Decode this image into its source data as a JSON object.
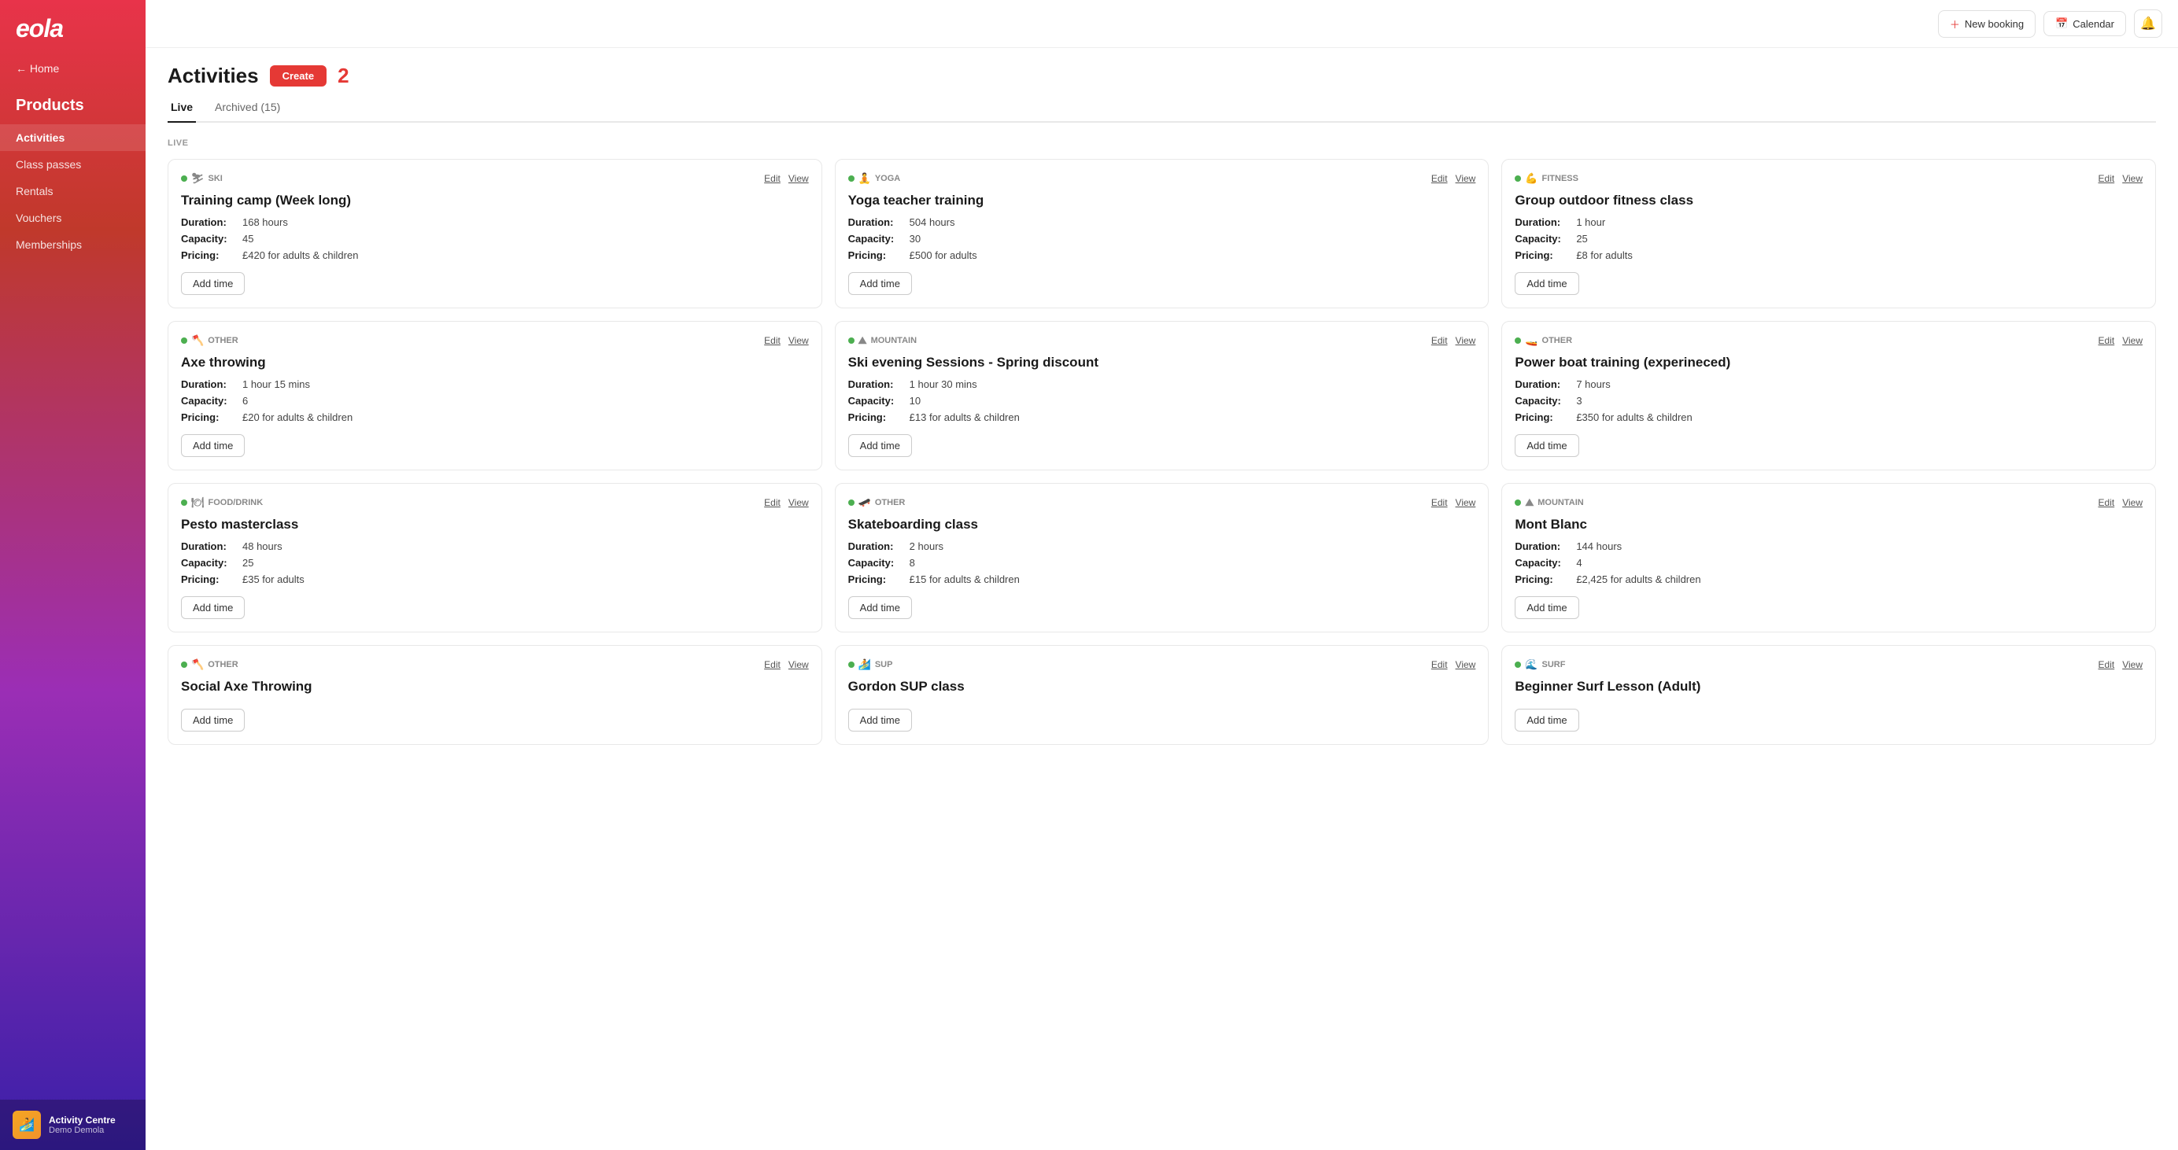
{
  "sidebar": {
    "logo": "eola",
    "home_label": "← Home",
    "products_label": "Products",
    "nav_items": [
      {
        "label": "Activities",
        "active": true
      },
      {
        "label": "Class passes",
        "active": false
      },
      {
        "label": "Rentals",
        "active": false
      },
      {
        "label": "Vouchers",
        "active": false
      },
      {
        "label": "Memberships",
        "active": false
      }
    ],
    "footer": {
      "title": "Activity Centre",
      "subtitle": "Demo Demola",
      "icon": "🏄"
    }
  },
  "header": {
    "new_booking_label": "New booking",
    "calendar_label": "Calendar",
    "bell_icon": "🔔"
  },
  "page": {
    "title": "Activities",
    "create_label": "Create",
    "badge": "2",
    "tabs": [
      {
        "label": "Live",
        "active": true
      },
      {
        "label": "Archived (15)",
        "active": false
      }
    ],
    "section_label": "LIVE"
  },
  "activities": [
    {
      "type": "SKI",
      "type_icon": "⛷",
      "title": "Training camp (Week long)",
      "duration": "168 hours",
      "capacity": "45",
      "pricing": "£420 for adults & children",
      "add_time_label": "Add time"
    },
    {
      "type": "YOGA",
      "type_icon": "🧘",
      "title": "Yoga teacher training",
      "duration": "504 hours",
      "capacity": "30",
      "pricing": "£500 for adults",
      "add_time_label": "Add time"
    },
    {
      "type": "FITNESS",
      "type_icon": "💪",
      "title": "Group outdoor fitness class",
      "duration": "1 hour",
      "capacity": "25",
      "pricing": "£8 for adults",
      "add_time_label": "Add time"
    },
    {
      "type": "OTHER",
      "type_icon": "🪓",
      "title": "Axe throwing",
      "duration": "1 hour 15 mins",
      "capacity": "6",
      "pricing": "£20 for adults & children",
      "add_time_label": "Add time"
    },
    {
      "type": "MOUNTAIN",
      "type_icon": "⛰",
      "title": "Ski evening Sessions - Spring discount",
      "duration": "1 hour 30 mins",
      "capacity": "10",
      "pricing": "£13 for adults & children",
      "add_time_label": "Add time"
    },
    {
      "type": "OTHER",
      "type_icon": "🚤",
      "title": "Power boat training (experineced)",
      "duration": "7 hours",
      "capacity": "3",
      "pricing": "£350 for adults & children",
      "add_time_label": "Add time"
    },
    {
      "type": "FOOD/DRINK",
      "type_icon": "🍽",
      "title": "Pesto masterclass",
      "duration": "48 hours",
      "capacity": "25",
      "pricing": "£35 for adults",
      "add_time_label": "Add time"
    },
    {
      "type": "OTHER",
      "type_icon": "🛹",
      "title": "Skateboarding class",
      "duration": "2 hours",
      "capacity": "8",
      "pricing": "£15 for adults & children",
      "add_time_label": "Add time"
    },
    {
      "type": "MOUNTAIN",
      "type_icon": "⛰",
      "title": "Mont Blanc",
      "duration": "144 hours",
      "capacity": "4",
      "pricing": "£2,425 for adults & children",
      "add_time_label": "Add time"
    },
    {
      "type": "OTHER",
      "type_icon": "🪓",
      "title": "Social Axe Throwing",
      "duration": "",
      "capacity": "",
      "pricing": "",
      "add_time_label": "Add time",
      "partial": true
    },
    {
      "type": "SUP",
      "type_icon": "🏄",
      "title": "Gordon SUP class",
      "duration": "",
      "capacity": "",
      "pricing": "",
      "add_time_label": "Add time",
      "partial": true
    },
    {
      "type": "SURF",
      "type_icon": "🌊",
      "title": "Beginner Surf Lesson (Adult)",
      "duration": "",
      "capacity": "",
      "pricing": "",
      "add_time_label": "Add time",
      "partial": true
    }
  ],
  "labels": {
    "duration": "Duration:",
    "capacity": "Capacity:",
    "pricing": "Pricing:",
    "edit": "Edit",
    "view": "View"
  }
}
